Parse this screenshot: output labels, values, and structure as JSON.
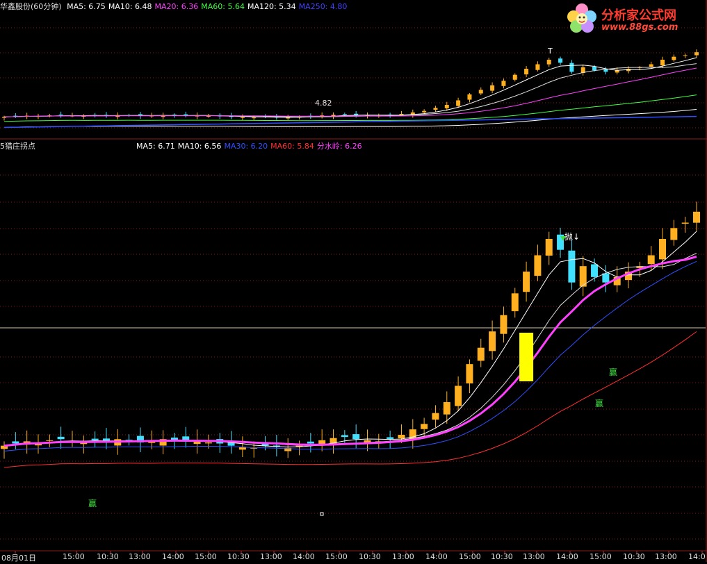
{
  "top_panel": {
    "stock": "华鑫股份(60分钟)",
    "legend": [
      {
        "label": "MA5: 6.75",
        "color": "#ffffff"
      },
      {
        "label": "MA10: 6.48",
        "color": "#ffffff"
      },
      {
        "label": "MA20: 6.36",
        "color": "#ff40ff"
      },
      {
        "label": "MA60: 5.64",
        "color": "#40ff40"
      },
      {
        "label": "MA120: 5.34",
        "color": "#ffffff"
      },
      {
        "label": "MA250: 4.80",
        "color": "#4040ff"
      }
    ],
    "annotation": "4.82",
    "marker": "T"
  },
  "bottom_panel": {
    "title": "5猎庄拐点",
    "legend": [
      {
        "label": "MA5: 6.71",
        "color": "#ffffff"
      },
      {
        "label": "MA10: 6.56",
        "color": "#ffffff"
      },
      {
        "label": "MA30: 6.20",
        "color": "#3050ff"
      },
      {
        "label": "MA60: 5.84",
        "color": "#ff3030"
      },
      {
        "label": "分水岭: 6.26",
        "color": "#ff40ff"
      }
    ],
    "signals": [
      "赢",
      "赢",
      "赢"
    ],
    "top_signal": "抛↓"
  },
  "x_axis": [
    "08月01日",
    "15:00",
    "10:30",
    "13:00",
    "14:00",
    "15:00",
    "10:30",
    "13:00",
    "14:00",
    "15:00",
    "10:30",
    "13:00",
    "14:00",
    "15:00",
    "10:30",
    "13:00",
    "14:00",
    "15:00",
    "10:30",
    "13:00",
    "14:0"
  ],
  "logo": {
    "title": "分析家公式网",
    "url": "www.88gs.com"
  },
  "colors": {
    "up": "#ffb020",
    "down": "#40e0ff",
    "grid": "#8b1a1a",
    "divider": "#8b1a1a",
    "yellow_box": "#ffff00"
  },
  "chart_data": [
    {
      "type": "candlestick",
      "title": "华鑫股份(60分钟)",
      "description_series": [
        "MA5",
        "MA10",
        "MA20",
        "MA60",
        "MA120",
        "MA250"
      ],
      "y_range": [
        4.3,
        7.3
      ],
      "closes": [
        4.8,
        4.82,
        4.84,
        4.83,
        4.85,
        4.86,
        4.84,
        4.83,
        4.85,
        4.84,
        4.86,
        4.85,
        4.83,
        4.84,
        4.86,
        4.85,
        4.84,
        4.85,
        4.83,
        4.82,
        4.8,
        4.79,
        4.78,
        4.8,
        4.79,
        4.78,
        4.8,
        4.82,
        4.85,
        4.87,
        4.88,
        4.86,
        4.85,
        4.84,
        4.86,
        4.9,
        4.95,
        5.0,
        5.1,
        5.2,
        5.35,
        5.55,
        5.7,
        5.85,
        6.0,
        6.2,
        6.4,
        6.55,
        6.7,
        6.6,
        6.3,
        6.45,
        6.35,
        6.3,
        6.35,
        6.4,
        6.45,
        6.55,
        6.7,
        6.8,
        6.85,
        6.95
      ]
    },
    {
      "type": "candlestick",
      "title": "5猎庄拐点",
      "series_names": [
        "MA5",
        "MA10",
        "MA30",
        "MA60",
        "分水岭"
      ],
      "y_range": [
        4.3,
        7.3
      ],
      "closes": [
        4.8,
        4.82,
        4.84,
        4.83,
        4.85,
        4.86,
        4.84,
        4.83,
        4.85,
        4.84,
        4.86,
        4.85,
        4.83,
        4.84,
        4.86,
        4.85,
        4.84,
        4.85,
        4.83,
        4.82,
        4.8,
        4.79,
        4.78,
        4.8,
        4.79,
        4.78,
        4.8,
        4.82,
        4.85,
        4.87,
        4.88,
        4.86,
        4.85,
        4.84,
        4.86,
        4.9,
        4.95,
        5.0,
        5.1,
        5.2,
        5.35,
        5.55,
        5.7,
        5.85,
        6.0,
        6.2,
        6.4,
        6.55,
        6.7,
        6.6,
        6.3,
        6.45,
        6.35,
        6.3,
        6.35,
        6.4,
        6.45,
        6.55,
        6.7,
        6.8,
        6.85,
        6.95
      ]
    }
  ]
}
